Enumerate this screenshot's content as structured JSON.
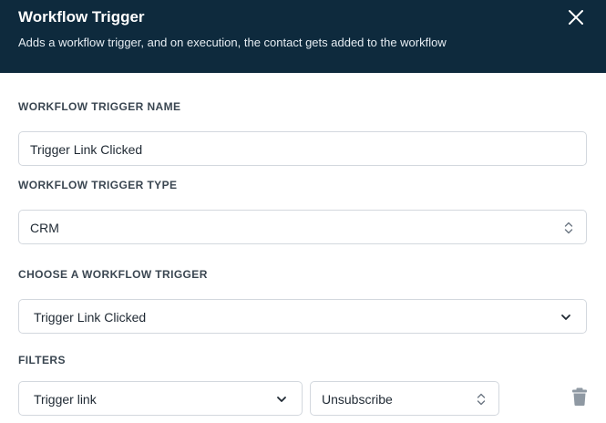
{
  "header": {
    "title": "Workflow Trigger",
    "subtitle": "Adds a workflow trigger, and on execution, the contact gets added to the workflow"
  },
  "form": {
    "name_label": "WORKFLOW TRIGGER NAME",
    "name_value": "Trigger Link Clicked",
    "type_label": "WORKFLOW TRIGGER TYPE",
    "type_value": "CRM",
    "choose_label": "CHOOSE A WORKFLOW TRIGGER",
    "choose_value": "Trigger Link Clicked",
    "filters_label": "FILTERS",
    "filter_field_value": "Trigger link",
    "filter_value": "Unsubscribe"
  },
  "icons": {
    "close": "close-icon",
    "select": "updown-chevron-icon",
    "dropdown": "chevron-down-icon",
    "delete": "trash-icon"
  },
  "colors": {
    "header_bg": "#0e2a3d",
    "border": "#d3d8de",
    "icon_gray": "#8f99a3"
  }
}
